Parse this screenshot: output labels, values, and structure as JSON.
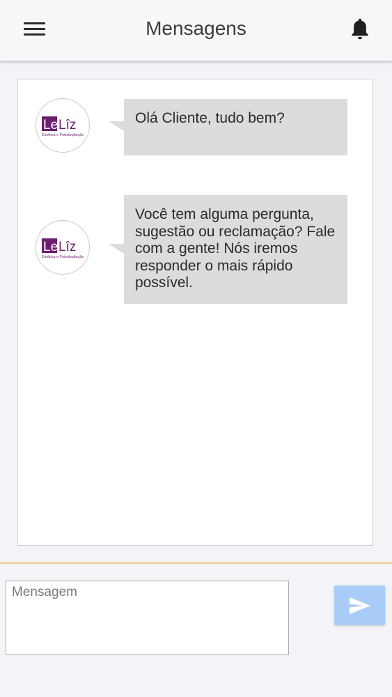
{
  "header": {
    "title": "Mensagens",
    "menu_icon": "hamburger-menu-icon",
    "notification_icon": "bell-icon"
  },
  "brand": {
    "logo_text_le": "Le",
    "logo_text_liz": "Lîz",
    "logo_tagline": "Estética e Fotodepilação",
    "color_primary": "#6b1f6e"
  },
  "messages": [
    {
      "text": "Olá Cliente, tudo bem?"
    },
    {
      "text": "Você tem alguma pergunta, sugestão ou reclamação? Fale com a gente! Nós iremos responder o mais rápido possível."
    }
  ],
  "composer": {
    "placeholder": "Mensagem",
    "send_icon": "send-icon"
  },
  "colors": {
    "bubble": "#dcdcdc",
    "send_button": "#a8ccf6",
    "divider": "#f2d3a6"
  }
}
